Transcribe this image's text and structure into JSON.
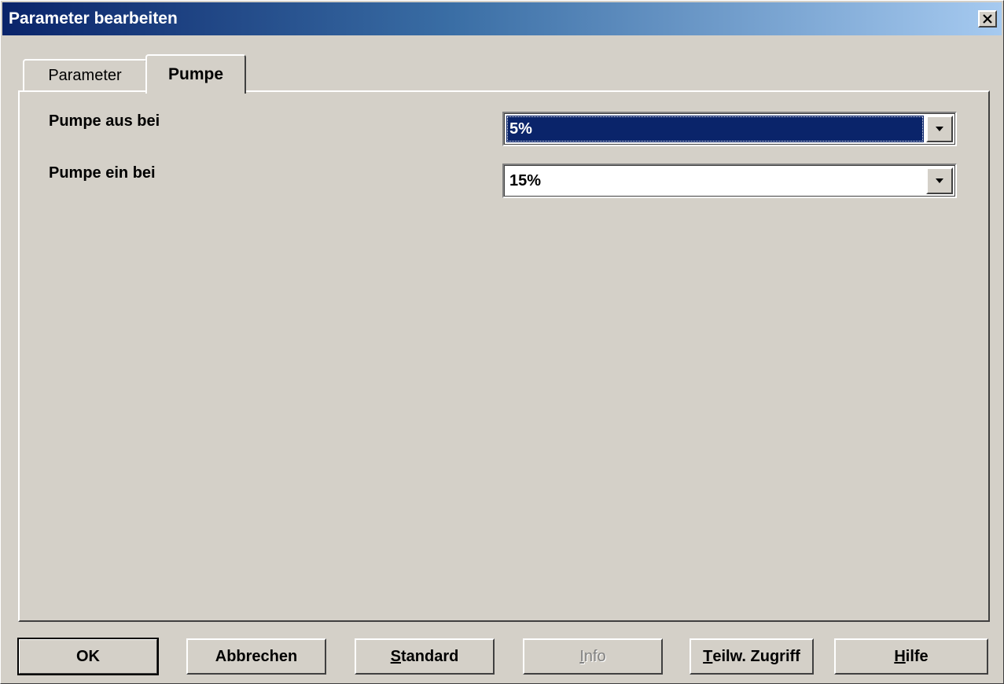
{
  "window": {
    "title": "Parameter bearbeiten",
    "close_glyph": "✕"
  },
  "tabs": [
    {
      "label": "Parameter",
      "active": false
    },
    {
      "label": "Pumpe",
      "active": true
    }
  ],
  "params": [
    {
      "label": "Pumpe aus bei",
      "value": "5%",
      "selected": true
    },
    {
      "label": "Pumpe ein bei",
      "value": "15%",
      "selected": false
    }
  ],
  "buttons": {
    "ok": "OK",
    "cancel": "Abbrechen",
    "standard": {
      "mnemonic": "S",
      "rest": "tandard"
    },
    "info": {
      "mnemonic": "I",
      "rest": "nfo"
    },
    "partial_access": {
      "mnemonic": "T",
      "rest": "eilw. Zugriff"
    },
    "help": {
      "mnemonic": "H",
      "rest": "ilfe"
    }
  },
  "colors": {
    "face": "#d4d0c8",
    "title_active": "#0a246a",
    "selection": "#0a246a"
  },
  "icons": {
    "close": "close-icon",
    "dropdown": "chevron-down-icon"
  }
}
